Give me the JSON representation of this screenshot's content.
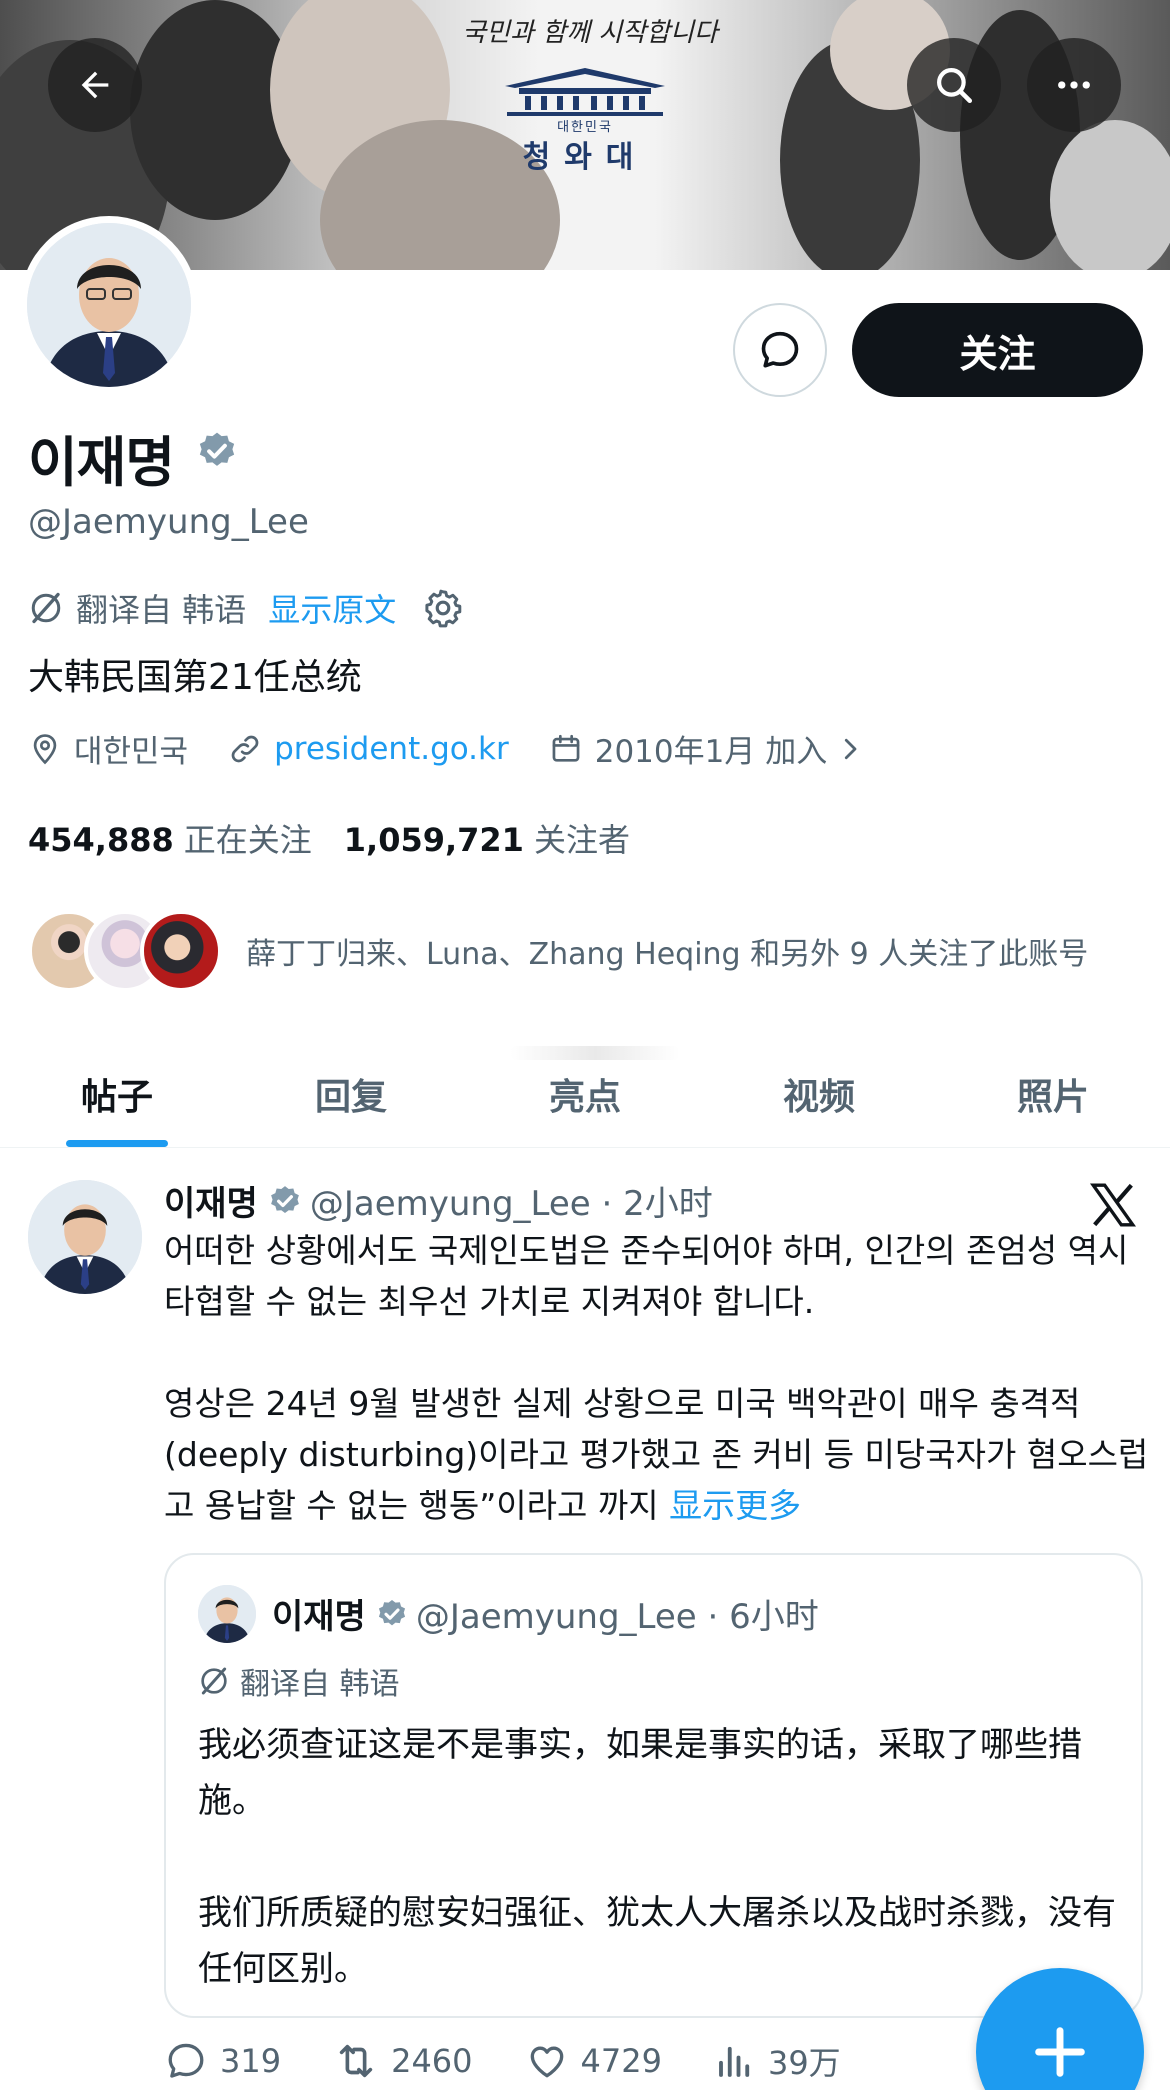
{
  "banner": {
    "slogan": "국민과 함께 시작합니다",
    "emblem_small": "대한민국",
    "emblem_big": "청와대"
  },
  "profile": {
    "name": "이재명",
    "handle": "@Jaemyung_Lee",
    "follow_label": "关注",
    "translated_from": "翻译自 韩语",
    "show_original": "显示原文",
    "bio": "大韩民国第21任总统",
    "location": "대한민국",
    "website": "president.go.kr",
    "joined": "2010年1月 加入",
    "following_count": "454,888",
    "following_label": "正在关注",
    "followers_count": "1,059,721",
    "followers_label": "关注者",
    "followed_by": "薛丁丁归来、Luna、Zhang Heqing 和另外 9 人关注了此账号"
  },
  "tabs": [
    "帖子",
    "回复",
    "亮点",
    "视频",
    "照片"
  ],
  "active_tab": "帖子",
  "tweet": {
    "name": "이재명",
    "handle_time": "@Jaemyung_Lee · 2小时",
    "paragraph1": "어떠한 상황에서도 국제인도법은 준수되어야 하며, 인간의 존엄성 역시 타협할 수 없는 최우선 가치로 지켜져야 합니다.",
    "paragraph2": "영상은 24년 9월 발생한 실제 상황으로 미국 백악관이 매우 충격적(deeply disturbing)이라고 평가했고 존 커비 등 미당국자가 혐오스럽고 용납할 수 없는 행동”이라고 까지",
    "show_more": "显示更多",
    "quote": {
      "name": "이재명",
      "handle_time": "@Jaemyung_Lee · 6小时",
      "translated_from": "翻译自 韩语",
      "paragraph1": "我必须查证这是不是事实，如果是事实的话，采取了哪些措施。",
      "paragraph2": "我们所质疑的慰安妇强征、犹太人大屠杀以及战时杀戮，没有任何区别。"
    },
    "replies": "319",
    "retweets": "2460",
    "likes": "4729",
    "views": "39万"
  },
  "colors": {
    "accent": "#1d9bf0",
    "text": "#0f1419",
    "muted": "#536471",
    "verified": "#829aab"
  },
  "icons": [
    "back-arrow-icon",
    "search-icon",
    "more-icon",
    "message-icon",
    "verified-icon",
    "translate-icon",
    "gear-icon",
    "location-icon",
    "link-icon",
    "calendar-icon",
    "chevron-right-icon",
    "x-logo-icon",
    "reply-icon",
    "retweet-icon",
    "like-icon",
    "views-icon",
    "plus-icon"
  ]
}
